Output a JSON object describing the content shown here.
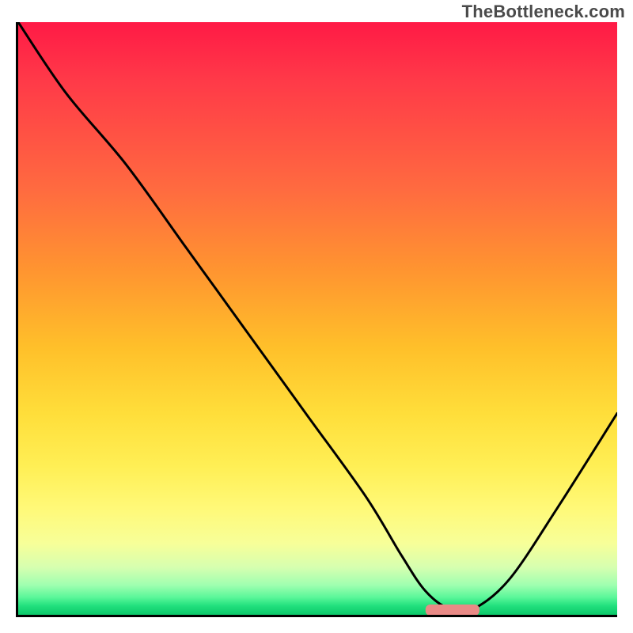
{
  "watermark": "TheBottleneck.com",
  "chart_data": {
    "type": "line",
    "title": "",
    "xlabel": "",
    "ylabel": "",
    "xlim": [
      0,
      100
    ],
    "ylim": [
      0,
      100
    ],
    "grid": false,
    "legend": false,
    "background_gradient_from_top": [
      "red",
      "orange",
      "yellow",
      "green"
    ],
    "series": [
      {
        "name": "bottleneck-curve",
        "x": [
          0,
          8,
          18,
          28,
          38,
          48,
          58,
          64,
          68,
          72,
          76,
          82,
          90,
          100
        ],
        "y": [
          100,
          88,
          76,
          62,
          48,
          34,
          20,
          10,
          4,
          1,
          1,
          6,
          18,
          34
        ]
      }
    ],
    "optimal_marker": {
      "x_range": [
        68,
        77
      ],
      "y": 0.8,
      "color": "#e98a86"
    }
  }
}
